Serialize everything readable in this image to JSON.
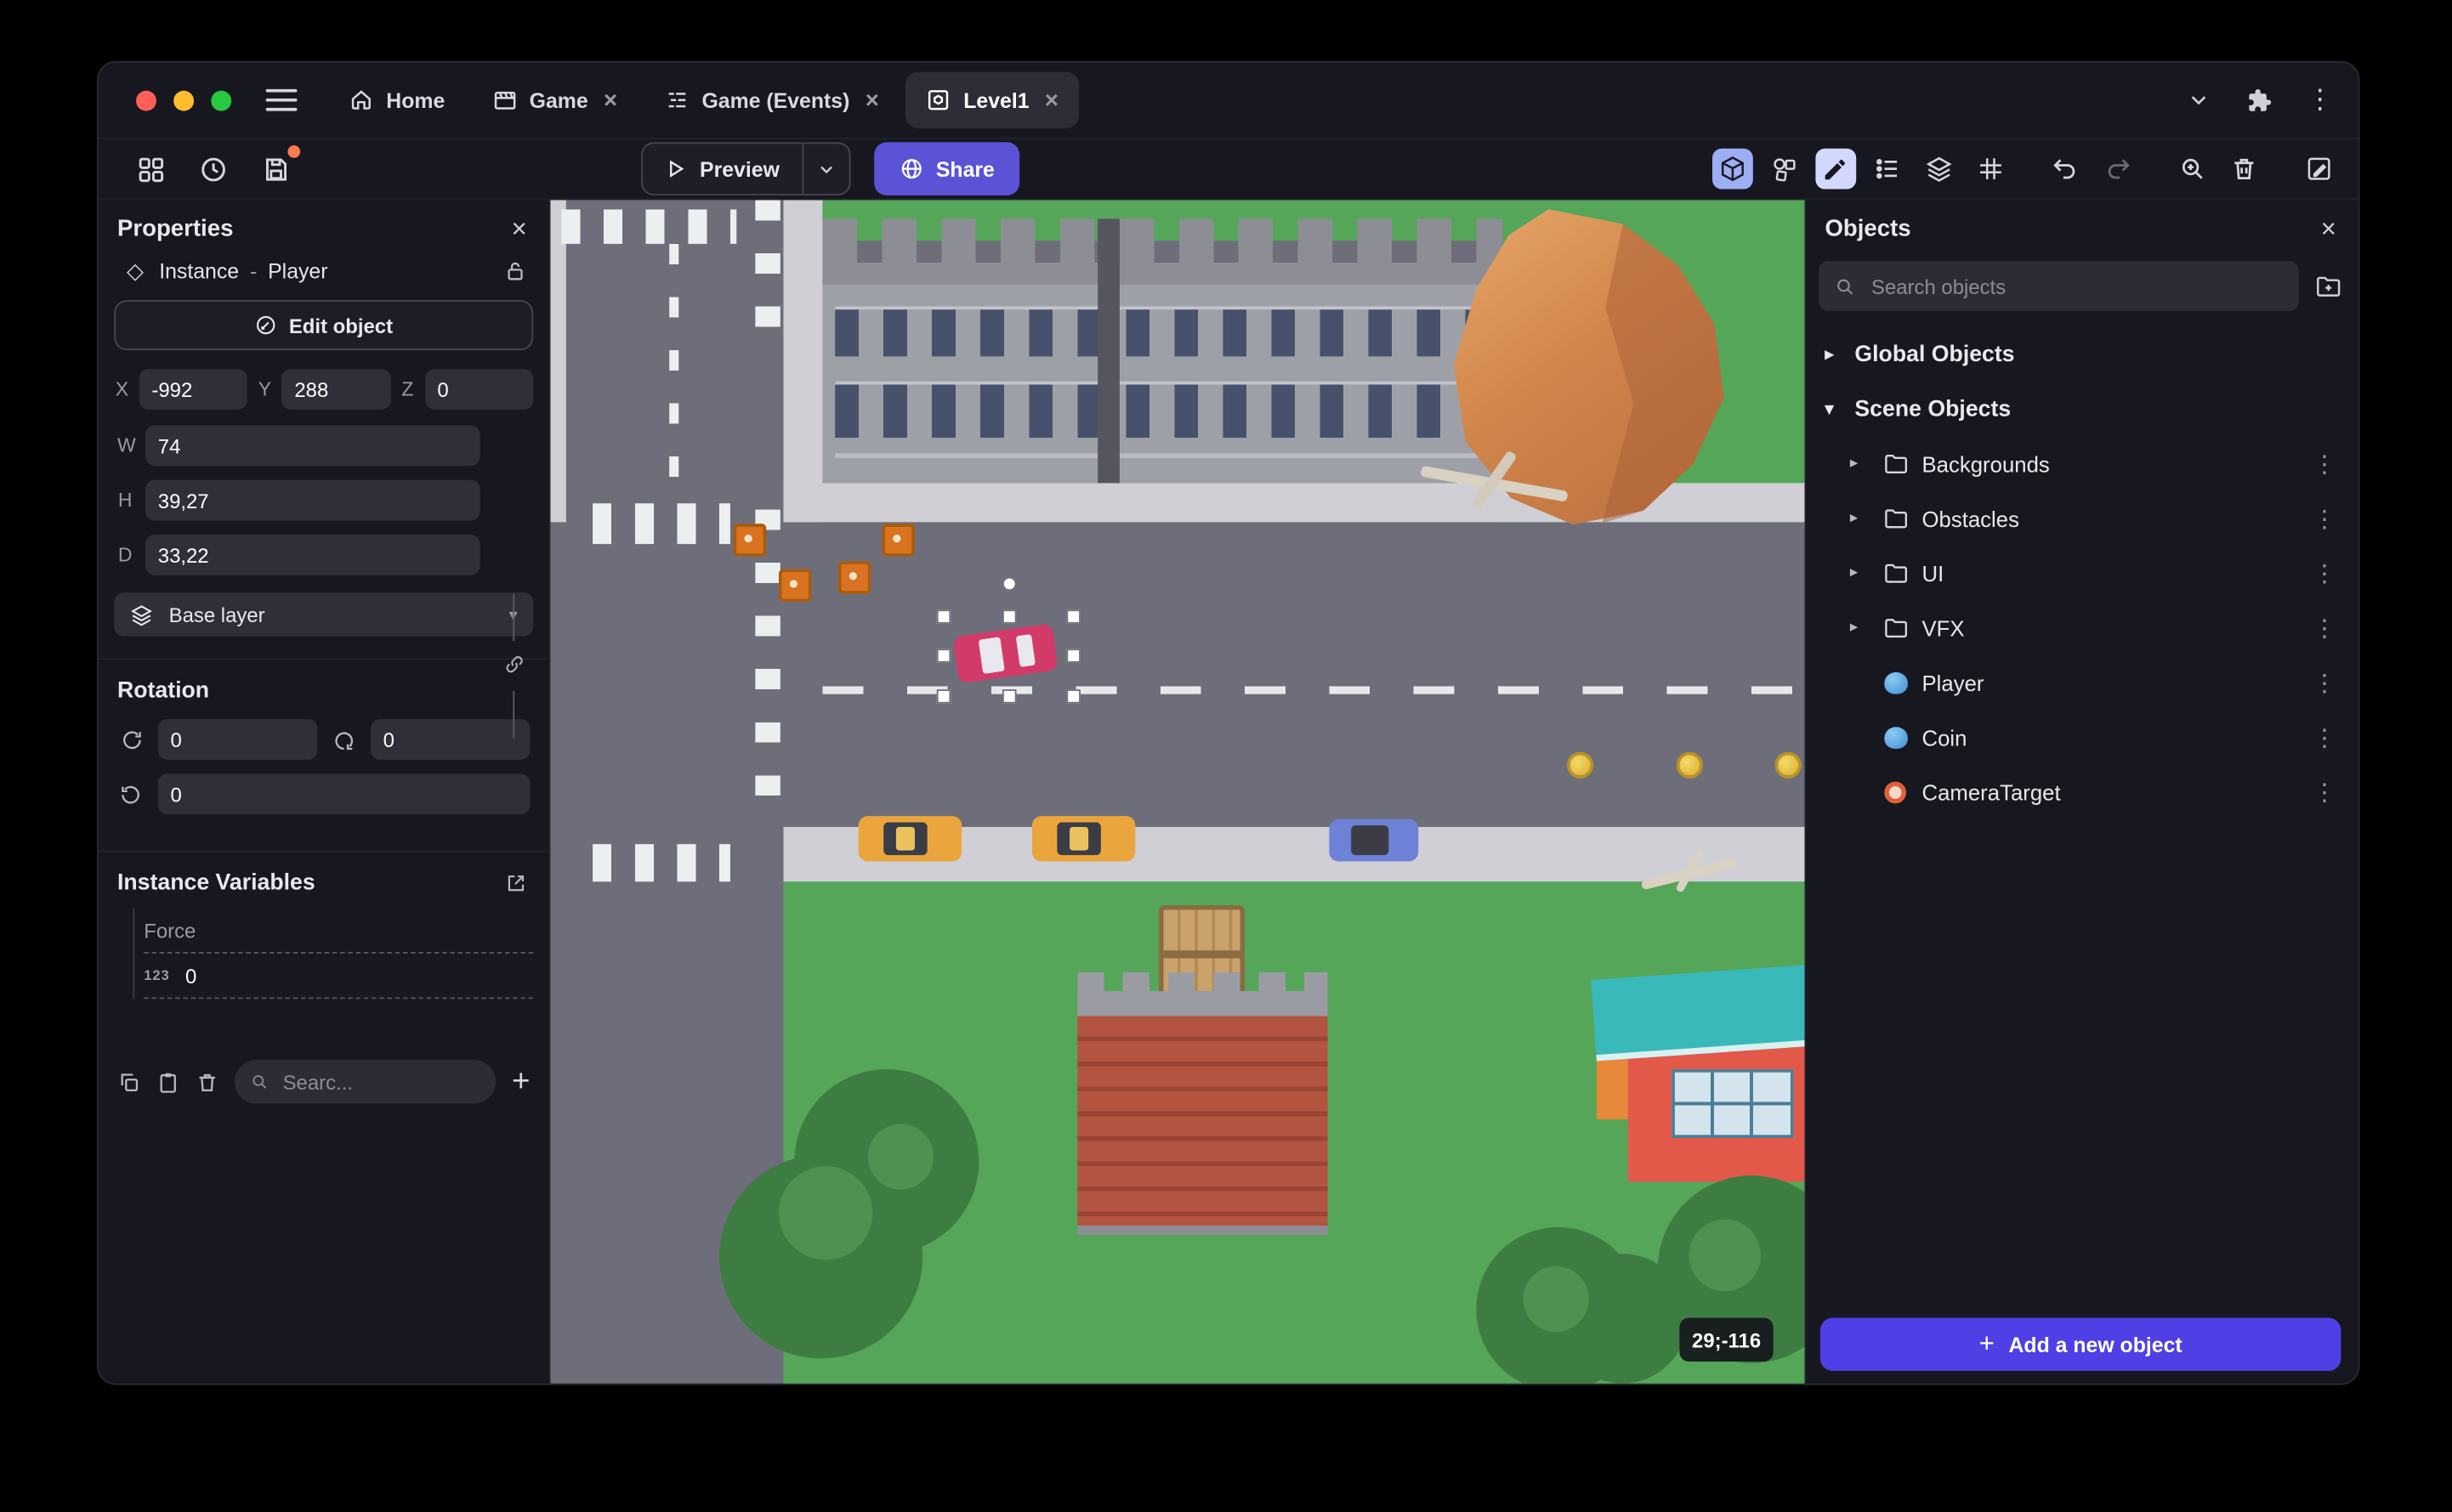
{
  "glyphs": {
    "close": "×",
    "kebab": "⋮",
    "chevron_right": "▸",
    "chevron_down": "▾",
    "plus": "+",
    "diamond": "◇",
    "hamburger": "≡"
  },
  "window": {
    "tabs": [
      {
        "label": "Home"
      },
      {
        "label": "Game"
      },
      {
        "label": "Game (Events)"
      },
      {
        "label": "Level1"
      }
    ]
  },
  "toolbar": {
    "preview_label": "Preview",
    "share_label": "Share"
  },
  "properties_panel": {
    "title": "Properties",
    "instance_label": "Instance",
    "instance_sep": "-",
    "instance_name": "Player",
    "edit_object_label": "Edit object",
    "x_label": "X",
    "x_value": "-992",
    "y_label": "Y",
    "y_value": "288",
    "z_label": "Z",
    "z_value": "0",
    "w_label": "W",
    "w_value": "74",
    "h_label": "H",
    "h_value": "39,27",
    "d_label": "D",
    "d_value": "33,22",
    "layer_value": "Base layer",
    "rotation_title": "Rotation",
    "rotation_x": "0",
    "rotation_y": "0",
    "rotation_z": "0",
    "variables_title": "Instance Variables",
    "variables": [
      {
        "name": "Force",
        "type_badge": "123",
        "value": "0"
      }
    ],
    "search_placeholder": "Searc..."
  },
  "objects_panel": {
    "title": "Objects",
    "search_placeholder": "Search objects",
    "global_objects_label": "Global Objects",
    "scene_objects_label": "Scene Objects",
    "items": [
      {
        "label": "Backgrounds",
        "type": "folder"
      },
      {
        "label": "Obstacles",
        "type": "folder"
      },
      {
        "label": "UI",
        "type": "folder"
      },
      {
        "label": "VFX",
        "type": "folder"
      },
      {
        "label": "Player",
        "type": "sprite"
      },
      {
        "label": "Coin",
        "type": "sprite"
      },
      {
        "label": "CameraTarget",
        "type": "target"
      }
    ],
    "add_button_label": "Add a new object"
  },
  "scene": {
    "coordinates_badge": "29;-116"
  },
  "colors": {
    "accent_purple": "#5b53d6",
    "add_button_purple": "#4e40e4",
    "grass_green": "#55a658",
    "road_gray": "#6e6e7a",
    "selection_pink": "#d23a69"
  }
}
